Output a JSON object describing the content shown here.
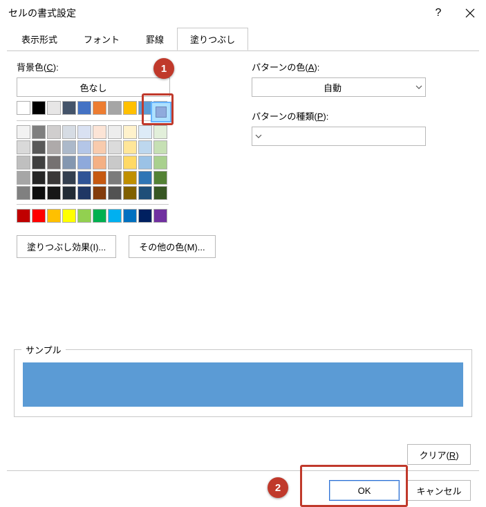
{
  "title": "セルの書式設定",
  "tabs": {
    "t1": "表示形式",
    "t2": "フォント",
    "t3": "罫線",
    "t4": "塗りつぶし"
  },
  "bg": {
    "label_pre": "背景色(",
    "label_u": "C",
    "label_post": "):",
    "nocolor": "色なし",
    "fill_effects_btn": "塗りつぶし効果(I)...",
    "more_colors_btn": "その他の色(M)..."
  },
  "pattern_color": {
    "label_pre": "パターンの色(",
    "label_u": "A",
    "label_post": "):",
    "value": "自動"
  },
  "pattern_type": {
    "label_pre": "パターンの種類(",
    "label_u": "P",
    "label_post": "):"
  },
  "sample_label": "サンプル",
  "sample_color": "#5b9bd5",
  "clear": {
    "pre": "クリア(",
    "u": "R",
    "post": ")"
  },
  "ok": "OK",
  "cancel": "キャンセル",
  "annotations": {
    "a1": "1",
    "a2": "2"
  },
  "palette": {
    "row1": [
      "#ffffff",
      "#000000",
      "#e7e6e6",
      "#44546a",
      "#4472c4",
      "#ed7d31",
      "#a5a5a5",
      "#ffc000",
      "#5b9bd5",
      "#9cc2e5"
    ],
    "theme": [
      [
        "#f2f2f2",
        "#7f7f7f",
        "#d0cece",
        "#d6dce4",
        "#d9e1f2",
        "#fce4d6",
        "#ededed",
        "#fff2cc",
        "#ddebf7",
        "#e2efda"
      ],
      [
        "#d9d9d9",
        "#595959",
        "#aeaaaa",
        "#acb9ca",
        "#b4c6e7",
        "#f8cbad",
        "#dbdbdb",
        "#ffe699",
        "#bdd7ee",
        "#c6e0b4"
      ],
      [
        "#bfbfbf",
        "#404040",
        "#757171",
        "#8497b0",
        "#8ea9db",
        "#f4b084",
        "#c9c9c9",
        "#ffd966",
        "#9bc2e6",
        "#a9d08e"
      ],
      [
        "#a6a6a6",
        "#262626",
        "#3a3838",
        "#333f4f",
        "#305496",
        "#c65911",
        "#7b7b7b",
        "#bf8f00",
        "#2f75b5",
        "#548235"
      ],
      [
        "#808080",
        "#0d0d0d",
        "#161616",
        "#222b35",
        "#203764",
        "#833c0c",
        "#525252",
        "#806000",
        "#1f4e78",
        "#375623"
      ]
    ],
    "standard": [
      "#c00000",
      "#ff0000",
      "#ffc000",
      "#ffff00",
      "#92d050",
      "#00b050",
      "#00b0f0",
      "#0070c0",
      "#002060",
      "#7030a0"
    ]
  }
}
